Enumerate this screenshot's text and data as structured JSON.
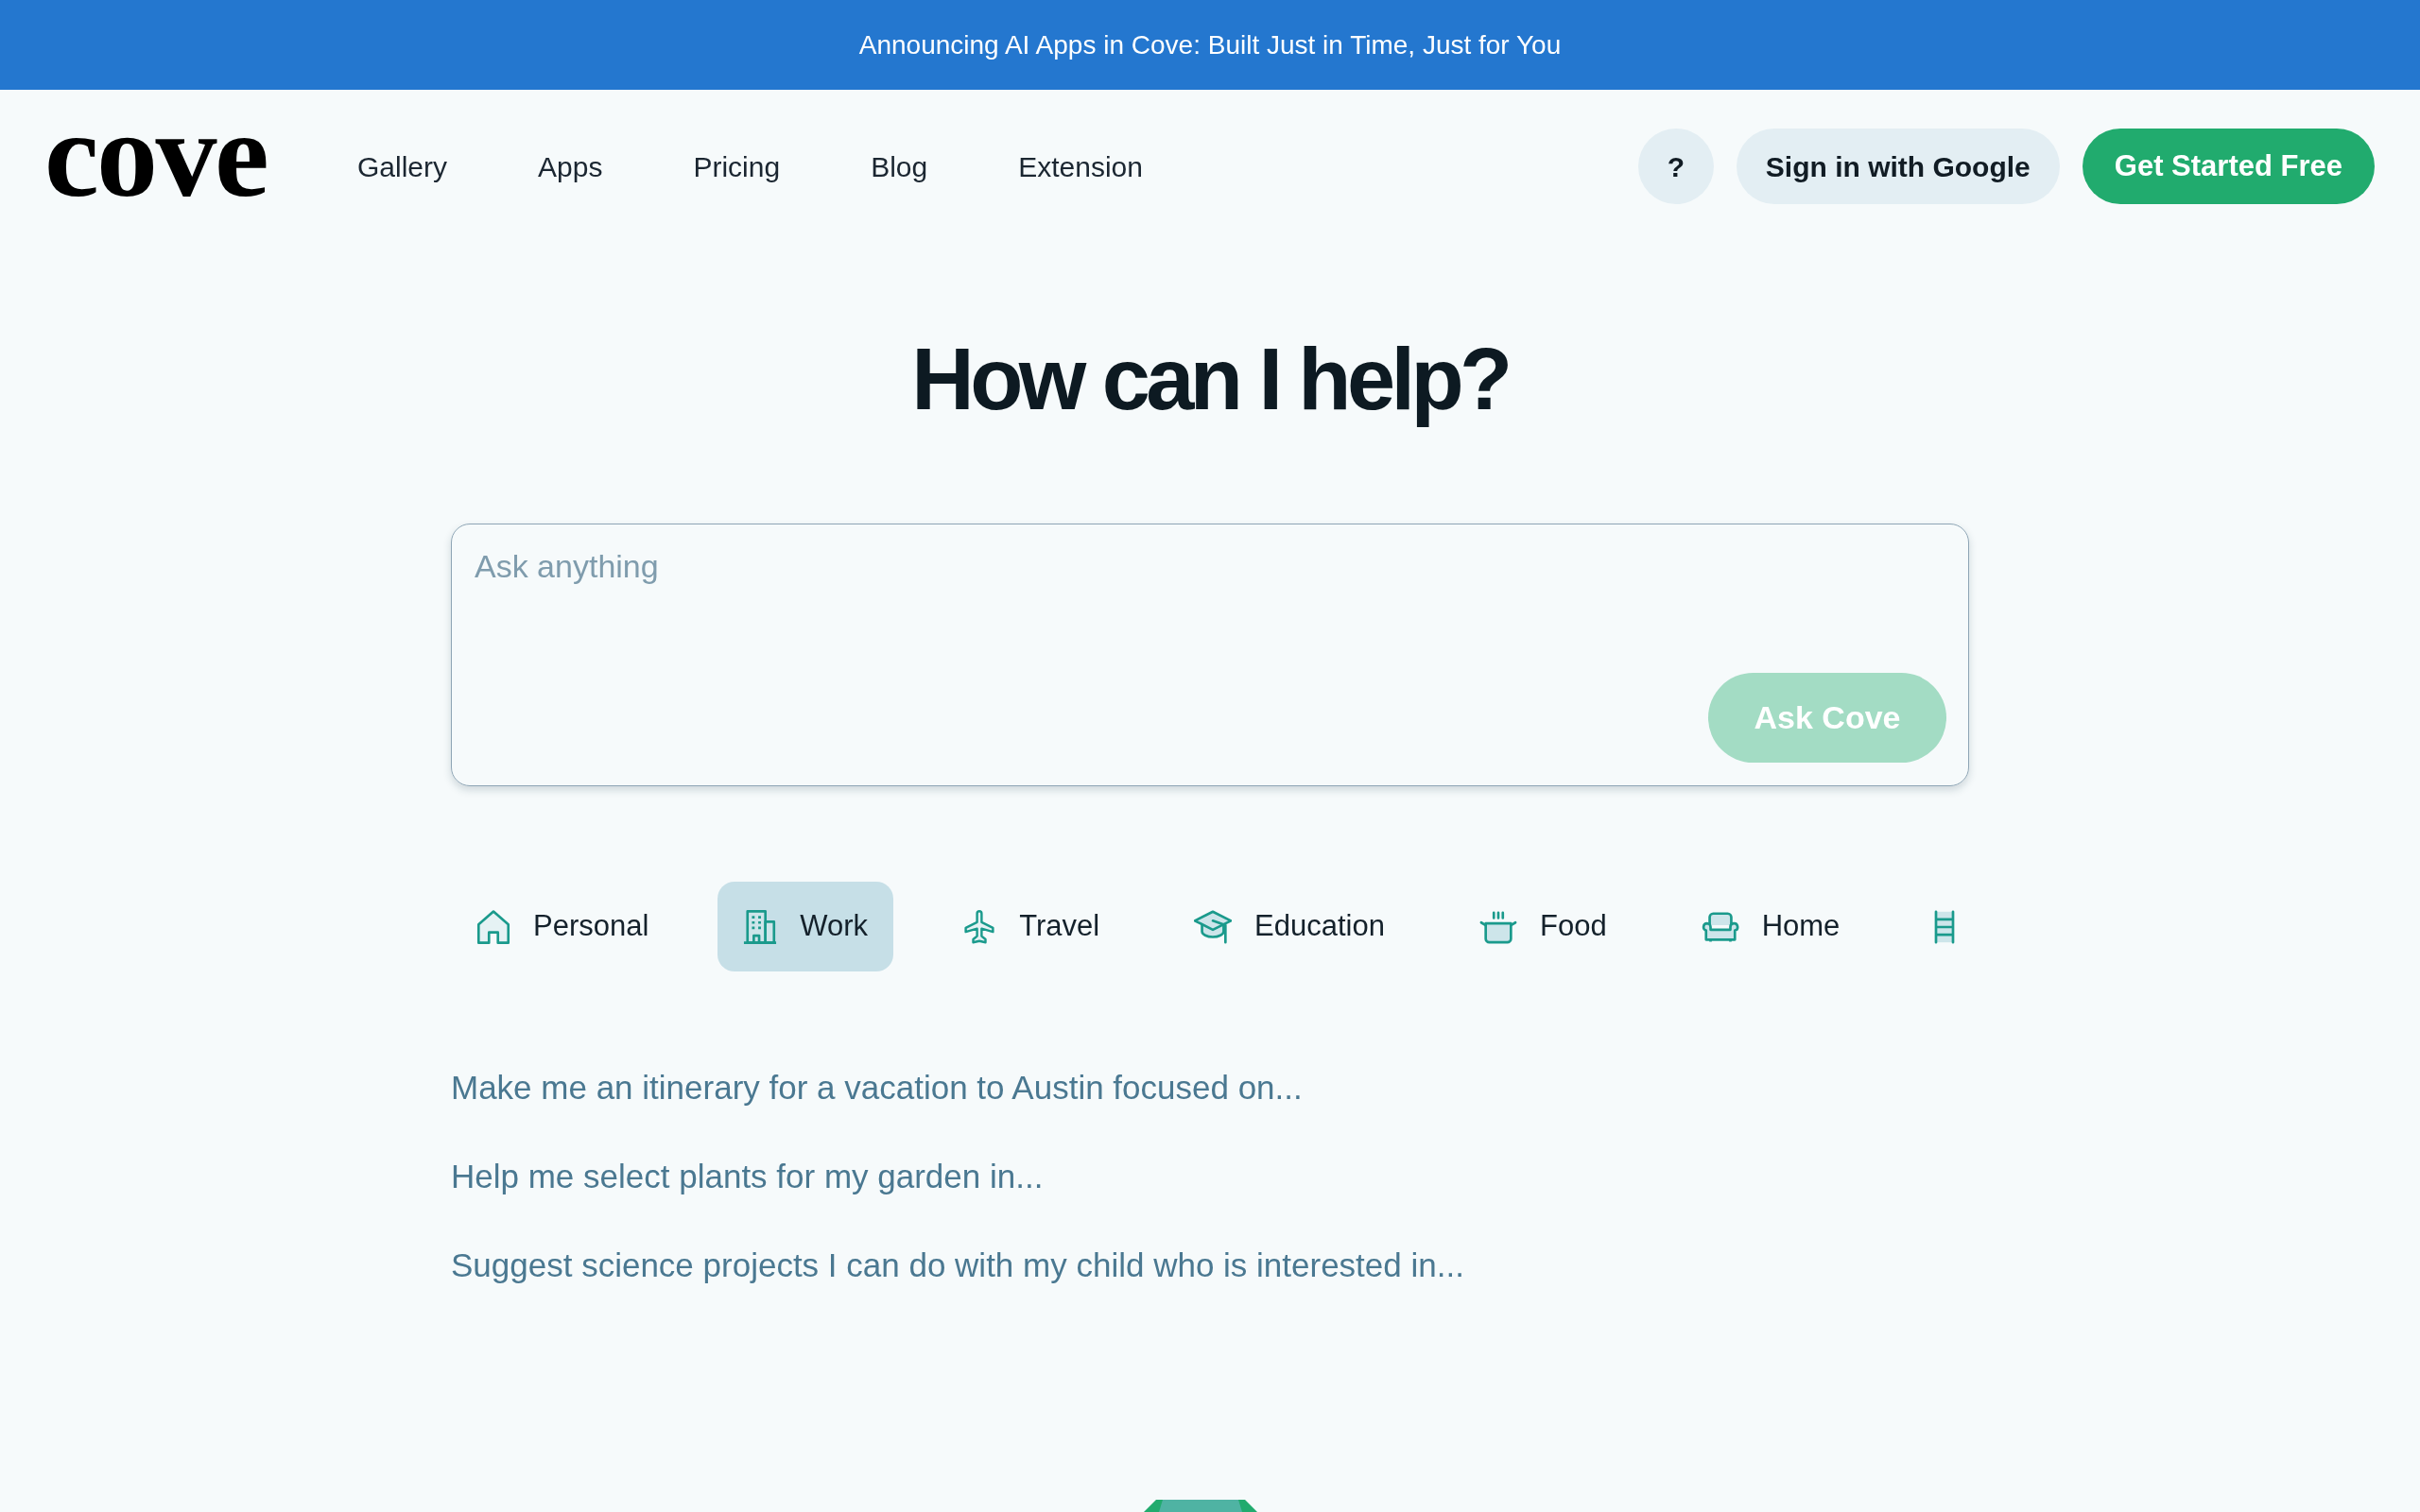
{
  "banner": {
    "text": "Announcing AI Apps in Cove: Built Just in Time, Just for You"
  },
  "header": {
    "logo": "cove",
    "nav": [
      "Gallery",
      "Apps",
      "Pricing",
      "Blog",
      "Extension"
    ],
    "help_button": "?",
    "sign_in_button": "Sign in with Google",
    "cta_button": "Get Started Free"
  },
  "hero": {
    "title": "How can I help?"
  },
  "prompt": {
    "placeholder": "Ask anything",
    "submit": {
      "label": "Ask Cove",
      "disabled": true
    }
  },
  "categories": [
    {
      "label": "Personal",
      "selected": false
    },
    {
      "label": "Work",
      "selected": true
    },
    {
      "label": "Travel",
      "selected": false
    },
    {
      "label": "Education",
      "selected": false
    },
    {
      "label": "Food",
      "selected": false
    },
    {
      "label": "Home",
      "selected": false
    },
    {
      "selected": false
    }
  ],
  "suggestions": [
    "Make me an itinerary for a vacation to Austin focused on...",
    "Help me select plants for my garden in...",
    "Suggest science projects I can do with my child who is interested in..."
  ]
}
